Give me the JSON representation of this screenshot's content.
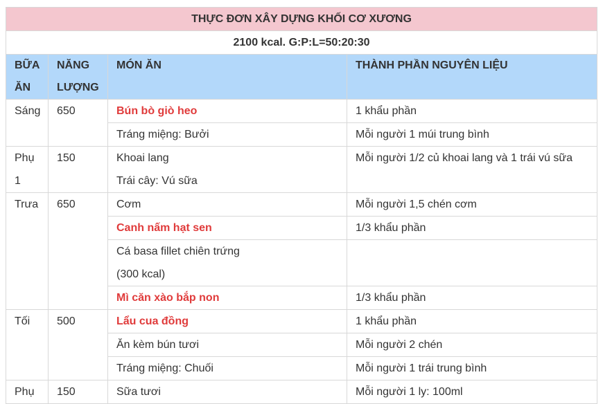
{
  "table": {
    "title": "THỰC ĐƠN XÂY DỰNG KHỐI CƠ XƯƠNG",
    "subtitle": "2100 kcal. G:P:L=50:20:30",
    "headers": {
      "meal_line1": "BỮA",
      "meal_line2": "ĂN",
      "energy_line1": "NĂNG",
      "energy_line2": "LƯỢNG",
      "dish": "MÓN ĂN",
      "ingredients": "THÀNH PHẦN NGUYÊN LIỆU"
    },
    "rows": {
      "sang": {
        "meal": "Sáng",
        "energy": "650",
        "dish1": "Bún bò giò heo",
        "ing1": "1 khẩu phần",
        "dish2": "Tráng miệng: Bưởi",
        "ing2": "Mỗi người 1 múi trung bình"
      },
      "phu1": {
        "meal_line1": "Phụ",
        "meal_line2": "1",
        "energy": "150",
        "dish_line1": "Khoai lang",
        "dish_line2": "Trái cây: Vú sữa",
        "ing": "Mỗi người 1/2 củ khoai lang và 1 trái vú sữa"
      },
      "trua": {
        "meal": "Trưa",
        "energy": "650",
        "dish1": "Cơm",
        "ing1": "Mỗi người 1,5 chén cơm",
        "dish2": "Canh nấm hạt sen",
        "ing2": "1/3 khẩu phần",
        "dish3_line1": "Cá basa fillet chiên trứng",
        "dish3_line2": "(300 kcal)",
        "ing3": "",
        "dish4": "Mì căn xào bắp non",
        "ing4": "1/3 khẩu phần"
      },
      "toi": {
        "meal": "Tối",
        "energy": "500",
        "dish1": "Lẩu cua đồng",
        "ing1": "1 khẩu phần",
        "dish2": "Ăn kèm bún tươi",
        "ing2": "Mỗi người 2 chén",
        "dish3": "Tráng miệng: Chuối",
        "ing3": "Mỗi người 1 trái trung bình"
      },
      "phu2": {
        "meal": "Phụ",
        "energy": "150",
        "dish": "Sữa tươi",
        "ing": "Mỗi người 1 ly: 100ml"
      }
    },
    "colors": {
      "title_bg": "#f4c7cf",
      "header_bg": "#b3d8fa",
      "highlight_text": "#e03b3b",
      "border": "#d8d8d8"
    }
  }
}
